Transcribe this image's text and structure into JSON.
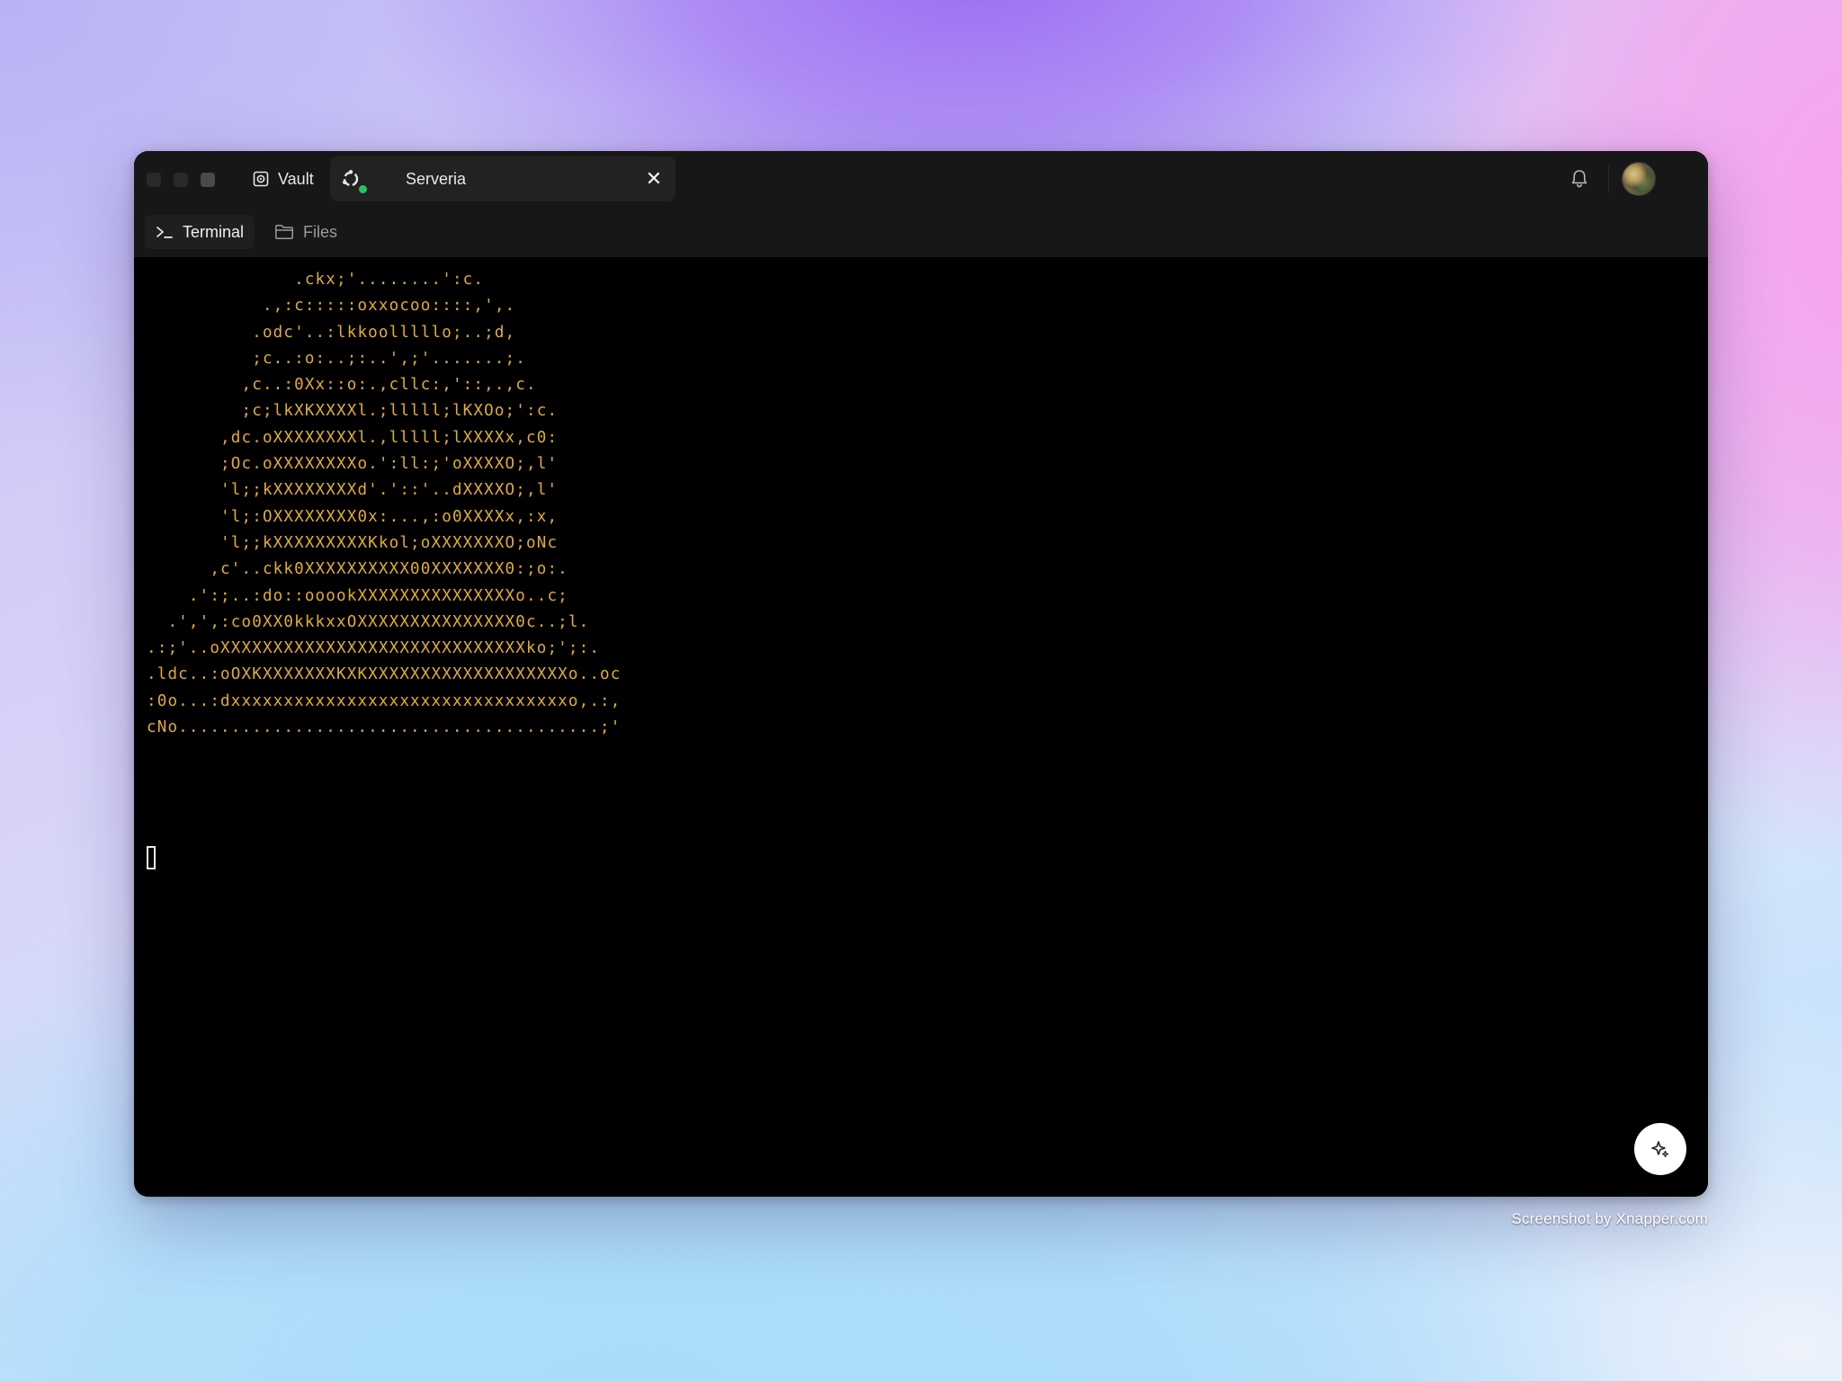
{
  "window": {
    "tabs": [
      {
        "label": "Vault",
        "icon": "vault-icon"
      },
      {
        "label": "Serveria",
        "icon": "ubuntu-icon",
        "status": "online",
        "status_color": "#27c561"
      }
    ],
    "close_label": "✕"
  },
  "subnav": {
    "terminal_label": "Terminal",
    "files_label": "Files"
  },
  "terminal": {
    "text_color": "#e0ad33",
    "lines": [
      "              .ckx;'........':c.",
      "           .,:c:::::oxxocoo::::,',.",
      "          .odc'..:lkkoolllllo;..;d,",
      "          ;c..:o:..;:..',;'.......;.",
      "         ,c..:0Xx::o:.,cllc:,'::,.,c.",
      "         ;c;lkXKXXXXl.;lllll;lKXOo;':c.",
      "       ,dc.oXXXXXXXXl.,lllll;lXXXXx,c0:",
      "       ;Oc.oXXXXXXXXo.':ll:;'oXXXXO;,l'",
      "       'l;;kXXXXXXXXd'.'::'..dXXXXO;,l'",
      "       'l;:OXXXXXXXX0x:...,:o0XXXXx,:x,",
      "       'l;;kXXXXXXXXXKkol;oXXXXXXXO;oNc",
      "      ,c'..ckk0XXXXXXXXXX00XXXXXXX0:;o:.",
      "    .':;..:do::ooookXXXXXXXXXXXXXXXo..c;",
      "  .',',:co0XX0kkkxxOXXXXXXXXXXXXXXX0c..;l.",
      ".:;'..oXXXXXXXXXXXXXXXXXXXXXXXXXXXXXko;';:.",
      ".ldc..:oOXKXXXXXXXKXKXXXXXXXXXXXXXXXXXXXo..oc",
      ":0o...:dxxxxxxxxxxxxxxxxxxxxxxxxxxxxxxxxo,.:,",
      "cNo........................................;'"
    ]
  },
  "watermark": "Screenshot by Xnapper.com"
}
